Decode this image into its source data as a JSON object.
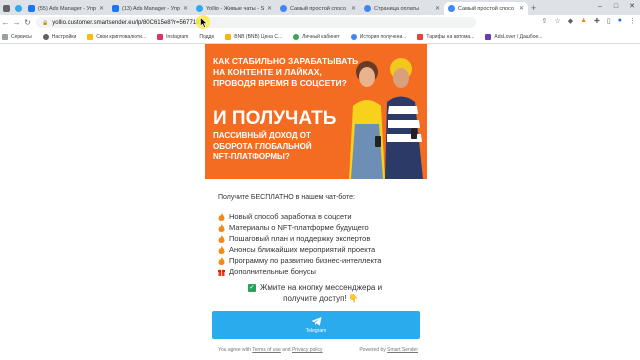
{
  "browser": {
    "tabs": [
      {
        "title": "",
        "favicon": "dark-tab-icon",
        "color": "#5f6368"
      },
      {
        "title": "",
        "favicon": "telegram-icon",
        "color": "#2aabee"
      },
      {
        "title": "(55) Ads Manager - Упр",
        "favicon": "ads-manager-icon",
        "color": "#1877f2"
      },
      {
        "title": "(13) Ads Manager - Упр",
        "favicon": "ads-manager-icon",
        "color": "#1877f2"
      },
      {
        "title": "Yollio - Живые чаты - S",
        "favicon": "yollio-icon",
        "color": "#2aabee"
      },
      {
        "title": "Самый простой спосо",
        "favicon": "page-icon",
        "color": "#4285f4"
      },
      {
        "title": "Страница оплаты",
        "favicon": "page-icon",
        "color": "#4285f4"
      },
      {
        "title": "Самый простой спосо",
        "favicon": "page-icon",
        "color": "#4285f4",
        "active": true
      }
    ],
    "new_tab": "+",
    "window_controls": [
      "–",
      "□",
      "✕"
    ],
    "url": "yollio.customer.smartsender.eu/lp/80C615e8?r=5677191",
    "bookmarks": [
      "Сервисы",
      "Настройки",
      "Свои криптовалюти...",
      "Instagram",
      "Подде",
      "BNB (BNB) Цена С...",
      "Личный кабинет",
      "История получени...",
      "Тарифы на автома...",
      "AdsLover / Дашбое..."
    ]
  },
  "banner": {
    "headline": "Как стабильно зарабатывать на контенте и лайках, проводя время в соцсети?",
    "big": "И ПОЛУЧАТЬ",
    "sub": "пассивный доход от оборота глобальной NFT-платформы?",
    "bg_color": "#f36c21"
  },
  "content": {
    "intro": "Получите БЕСПЛАТНО в нашем чат-боте:",
    "features": [
      {
        "text": "Новый способ заработка в соцсети",
        "icon": "fire-icon"
      },
      {
        "text": "Материалы о NFT-платформе будущего",
        "icon": "fire-icon"
      },
      {
        "text": "Пошаговый план и поддержку экспертов",
        "icon": "fire-icon"
      },
      {
        "text": "Анонсы ближайших мероприятий проекта",
        "icon": "fire-icon"
      },
      {
        "text": "Программу по развитию бизнес-интеллекта",
        "icon": "fire-icon"
      },
      {
        "text": "Дополнительные бонусы",
        "icon": "gift-icon"
      }
    ],
    "consent": "Жмите на кнопку мессенджера и получите доступ! 👇",
    "checkbox_mark": "✓",
    "telegram_label": "Telegram",
    "telegram_color": "#2aabee"
  },
  "footer": {
    "agree_prefix": "You agree with",
    "terms": "Terms of use",
    "and": "and",
    "privacy": "Privacy policy",
    "powered_prefix": "Powered by",
    "powered_by": "Smart Sender"
  }
}
